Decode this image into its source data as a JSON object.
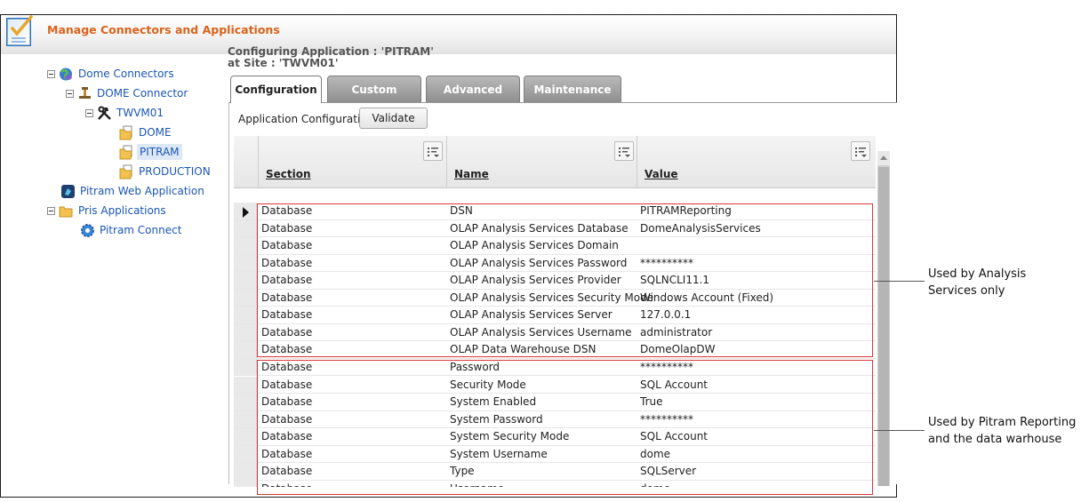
{
  "app": {
    "title": "Manage Connectors and Applications"
  },
  "tree": {
    "items": [
      {
        "label": "Dome Connectors",
        "icon": "globe-icon"
      },
      {
        "label": "DOME Connector",
        "icon": "connector-icon"
      },
      {
        "label": "TWVM01",
        "icon": "tools-icon"
      },
      {
        "label": "DOME",
        "icon": "folder-doc-icon"
      },
      {
        "label": "PITRAM",
        "icon": "folder-doc-icon",
        "selected": true
      },
      {
        "label": "PRODUCTION",
        "icon": "folder-doc-icon"
      },
      {
        "label": "Pitram Web Application",
        "icon": "web-app-icon"
      },
      {
        "label": "Pris Applications",
        "icon": "folder-icon"
      },
      {
        "label": "Pitram Connect",
        "icon": "gear-icon"
      }
    ]
  },
  "config": {
    "title_line1": "Configuring Application : 'PITRAM'",
    "title_line2": "at Site : 'TWVM01'",
    "app_config_label": "Application Configuration",
    "validate_label": "Validate"
  },
  "tabs": [
    {
      "label": "Configuration",
      "active": true
    },
    {
      "label": "Custom"
    },
    {
      "label": "Advanced"
    },
    {
      "label": "Maintenance"
    }
  ],
  "grid": {
    "columns": [
      "Section",
      "Name",
      "Value"
    ],
    "rows": [
      {
        "section": "Database",
        "name": "DSN",
        "value": "PITRAMReporting"
      },
      {
        "section": "Database",
        "name": "OLAP Analysis Services Database",
        "value": "DomeAnalysisServices"
      },
      {
        "section": "Database",
        "name": "OLAP Analysis Services Domain",
        "value": ""
      },
      {
        "section": "Database",
        "name": "OLAP Analysis Services Password",
        "value": "**********"
      },
      {
        "section": "Database",
        "name": "OLAP Analysis Services Provider",
        "value": "SQLNCLI11.1"
      },
      {
        "section": "Database",
        "name": "OLAP Analysis Services Security Mode",
        "value": "Windows Account (Fixed)"
      },
      {
        "section": "Database",
        "name": "OLAP Analysis Services Server",
        "value": "127.0.0.1"
      },
      {
        "section": "Database",
        "name": "OLAP Analysis Services Username",
        "value": "administrator"
      },
      {
        "section": "Database",
        "name": "OLAP Data Warehouse DSN",
        "value": "DomeOlapDW"
      },
      {
        "section": "Database",
        "name": "Password",
        "value": "**********"
      },
      {
        "section": "Database",
        "name": "Security Mode",
        "value": "SQL Account"
      },
      {
        "section": "Database",
        "name": "System Enabled",
        "value": "True"
      },
      {
        "section": "Database",
        "name": "System Password",
        "value": "**********"
      },
      {
        "section": "Database",
        "name": "System Security Mode",
        "value": "SQL Account"
      },
      {
        "section": "Database",
        "name": "System Username",
        "value": "dome"
      },
      {
        "section": "Database",
        "name": "Type",
        "value": "SQLServer"
      },
      {
        "section": "Database",
        "name": "Username",
        "value": "dome"
      }
    ]
  },
  "annotations": {
    "analysis_line1": "Used by Analysis",
    "analysis_line2": "Services only",
    "reporting_line1": "Used by Pitram Reporting",
    "reporting_line2": "and the data warhouse"
  },
  "colors": {
    "accent": "#d9631a",
    "link": "#1a56b4",
    "annotation": "#d8383a"
  }
}
